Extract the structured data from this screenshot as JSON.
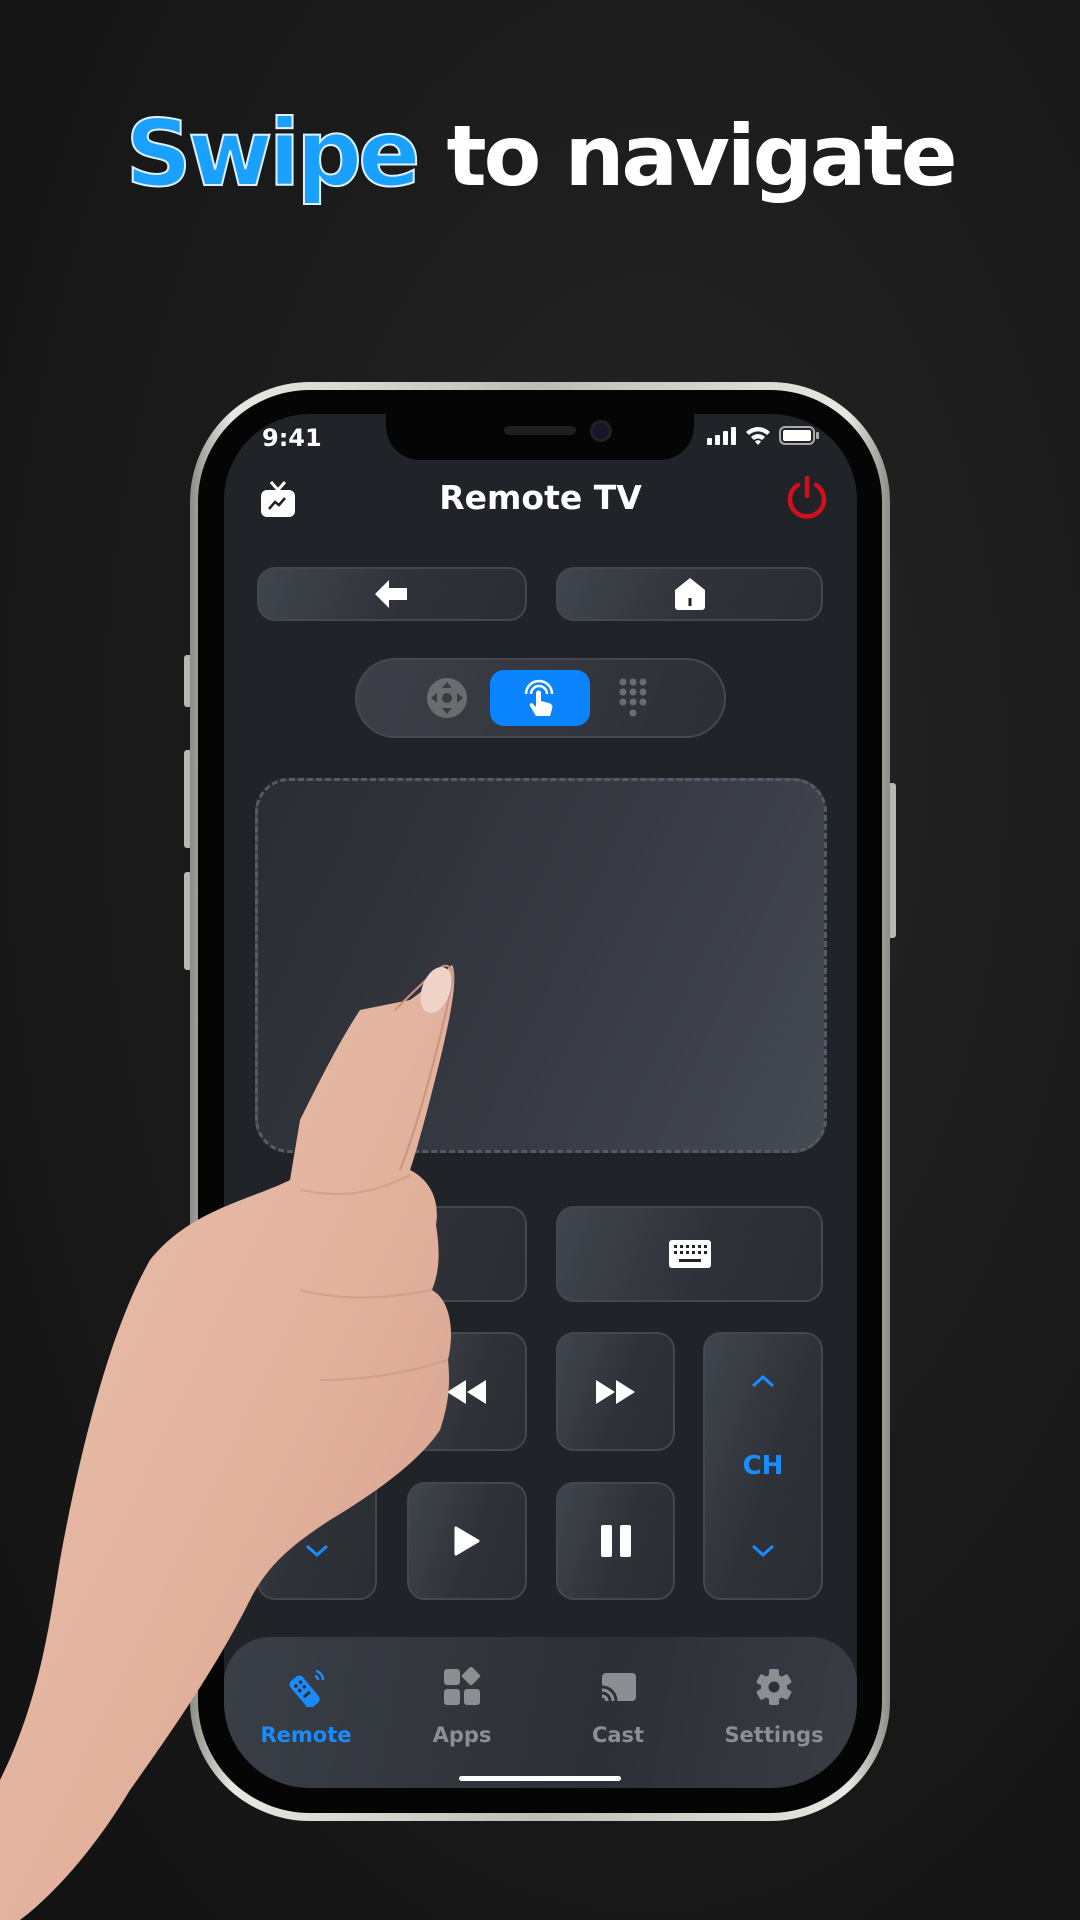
{
  "headline": {
    "highlight": "Swipe",
    "rest": "to navigate"
  },
  "colors": {
    "accent": "#1a8cff",
    "headline_blue": "#1aa0ff",
    "power": "#d0101a",
    "screen_bg": "#202328"
  },
  "status_bar": {
    "time": "9:41",
    "icons": [
      "signal-icon",
      "wifi-icon",
      "battery-icon"
    ]
  },
  "header": {
    "title": "Remote TV",
    "left_icon": "tv-cast-icon",
    "right_icon": "power-icon"
  },
  "top_buttons": [
    {
      "icon": "back-arrow-icon"
    },
    {
      "icon": "home-icon"
    }
  ],
  "mode_switch": {
    "items": [
      {
        "icon": "dpad-icon",
        "active": false
      },
      {
        "icon": "touch-icon",
        "active": true
      },
      {
        "icon": "numpad-icon",
        "active": false
      }
    ]
  },
  "touchpad": {
    "icon": "touchpad"
  },
  "controls": {
    "keyboard_icon": "keyboard-icon",
    "rewind_icon": "rewind-icon",
    "forward_icon": "fast-forward-icon",
    "play_icon": "play-icon",
    "pause_icon": "pause-icon",
    "channel_label": "CH"
  },
  "bottom_nav": {
    "items": [
      {
        "label": "Remote",
        "icon": "remote-icon",
        "active": true
      },
      {
        "label": "Apps",
        "icon": "apps-icon",
        "active": false
      },
      {
        "label": "Cast",
        "icon": "cast-icon",
        "active": false
      },
      {
        "label": "Settings",
        "icon": "gear-icon",
        "active": false
      }
    ]
  }
}
